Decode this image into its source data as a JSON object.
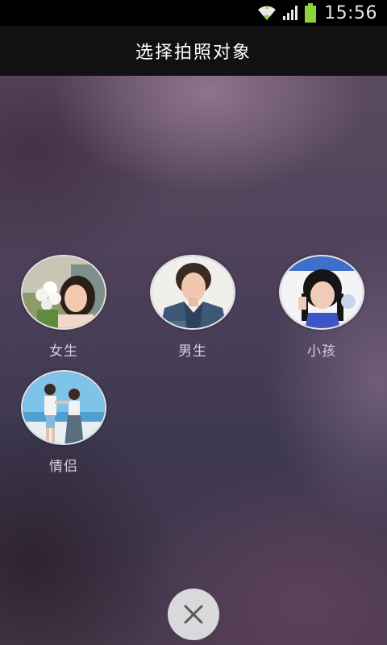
{
  "status_bar": {
    "time": "15:56",
    "icons": [
      "wifi-icon",
      "signal-icon",
      "battery-icon"
    ]
  },
  "header": {
    "title": "选择拍照对象"
  },
  "options": [
    {
      "label": "女生",
      "icon": "photo-female-avatar"
    },
    {
      "label": "男生",
      "icon": "photo-male-avatar"
    },
    {
      "label": "小孩",
      "icon": "photo-child-avatar"
    },
    {
      "label": "情侣",
      "icon": "photo-couple-avatar"
    }
  ],
  "close_button": {
    "icon": "close-icon"
  },
  "colors": {
    "status_bar_bg": "#000000",
    "title_bar_bg": "#111013",
    "battery": "#8fd13a",
    "close_button_bg": "#d9d9db"
  }
}
